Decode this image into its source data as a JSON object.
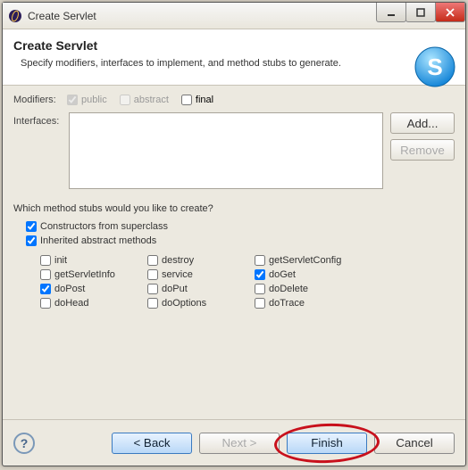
{
  "titlebar": {
    "text": "Create Servlet"
  },
  "header": {
    "title": "Create Servlet",
    "subtitle": "Specify modifiers, interfaces to implement, and method stubs to generate."
  },
  "modifiers": {
    "label": "Modifiers:",
    "public": "public",
    "abstract": "abstract",
    "final": "final"
  },
  "interfaces": {
    "label": "Interfaces:",
    "add": "Add...",
    "remove": "Remove"
  },
  "stubs": {
    "question": "Which method stubs would you like to create?",
    "constructors": "Constructors from superclass",
    "inherited": "Inherited abstract methods",
    "grid": {
      "init": "init",
      "destroy": "destroy",
      "getServletConfig": "getServletConfig",
      "getServletInfo": "getServletInfo",
      "service": "service",
      "doGet": "doGet",
      "doPost": "doPost",
      "doPut": "doPut",
      "doDelete": "doDelete",
      "doHead": "doHead",
      "doOptions": "doOptions",
      "doTrace": "doTrace"
    }
  },
  "footer": {
    "back": "< Back",
    "next": "Next >",
    "finish": "Finish",
    "cancel": "Cancel"
  }
}
